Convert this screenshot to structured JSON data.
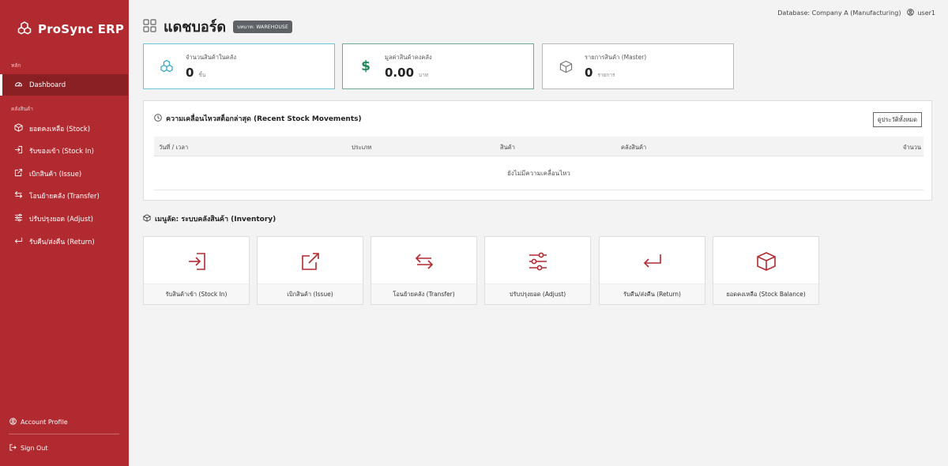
{
  "sidebar": {
    "brand": "ProSync ERP",
    "section_main": "หลัก",
    "dashboard_label": "Dashboard",
    "section_inventory": "คลังสินค้า",
    "items": [
      {
        "label": "ยอดคงเหลือ (Stock)",
        "icon": "box-icon"
      },
      {
        "label": "รับของเข้า (Stock In)",
        "icon": "sign-in-icon"
      },
      {
        "label": "เบิกสินค้า (Issue)",
        "icon": "external-link-icon"
      },
      {
        "label": "โอนย้ายคลัง (Transfer)",
        "icon": "arrows-exchange-icon"
      },
      {
        "label": "ปรับปรุงยอด (Adjust)",
        "icon": "sliders-icon"
      },
      {
        "label": "รับคืน/ส่งคืน (Return)",
        "icon": "return-icon"
      }
    ],
    "account_profile": "Account Profile",
    "sign_out": "Sign Out"
  },
  "header": {
    "title": "แดชบอร์ด",
    "role_badge": "บทบาท: WAREHOUSE",
    "database": "Database: Company A (Manufacturing)",
    "user": "user1"
  },
  "stats": [
    {
      "label": "จำนวนสินค้าในคลัง",
      "value": "0",
      "unit": "ชิ้น",
      "icon": "cubes-icon",
      "color": "#2aa3c4"
    },
    {
      "label": "มูลค่าสินค้าคงคลัง",
      "value": "0.00",
      "unit": "บาท",
      "icon": "dollar-icon",
      "color": "#1e8a5a"
    },
    {
      "label": "รายการสินค้า (Master)",
      "value": "0",
      "unit": "รายการ",
      "icon": "box-icon",
      "color": "#777777"
    }
  ],
  "movements": {
    "title": "ความเคลื่อนไหวสต็อกล่าสุด (Recent Stock Movements)",
    "view_all": "ดูประวัติทั้งหมด",
    "columns": [
      "วันที่ / เวลา",
      "ประเภท",
      "สินค้า",
      "คลังสินค้า",
      "จำนวน"
    ],
    "empty": "ยังไม่มีความเคลื่อนไหว"
  },
  "shortcuts": {
    "title": "เมนูลัด: ระบบคลังสินค้า (Inventory)",
    "tiles": [
      {
        "label": "รับสินค้าเข้า (Stock In)",
        "icon": "sign-in-icon"
      },
      {
        "label": "เบิกสินค้า (Issue)",
        "icon": "external-link-icon"
      },
      {
        "label": "โอนย้ายคลัง (Transfer)",
        "icon": "arrows-exchange-icon"
      },
      {
        "label": "ปรับปรุงยอด (Adjust)",
        "icon": "sliders-icon"
      },
      {
        "label": "รับคืน/ส่งคืน (Return)",
        "icon": "return-icon"
      },
      {
        "label": "ยอดคงเหลือ (Stock Balance)",
        "icon": "box-icon"
      }
    ]
  },
  "colors": {
    "sidebar": "#b02a30",
    "sidebar_active": "#8a1f24",
    "accent": "#b02a30"
  }
}
